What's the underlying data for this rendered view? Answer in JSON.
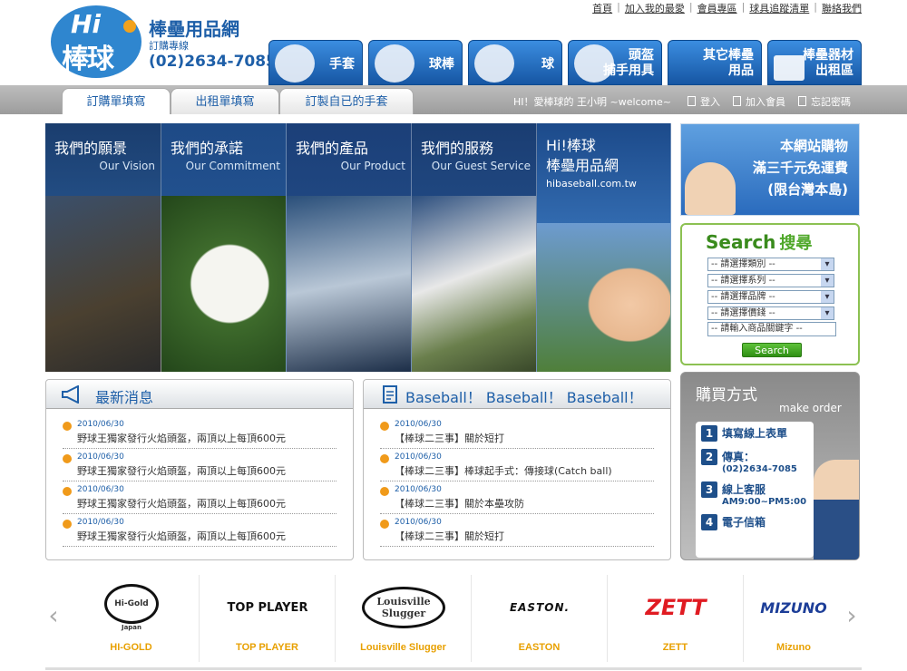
{
  "brand": {
    "logo_text": "Hi! 棒球",
    "name": "棒壘用品網",
    "order_label": "訂購專線",
    "phone": "(02)2634-7085"
  },
  "top_links": [
    "首頁",
    "加入我的最愛",
    "會員專區",
    "球具追蹤清單",
    "聯絡我們"
  ],
  "nav": [
    {
      "label": "手套",
      "icon": "glove-icon"
    },
    {
      "label": "球棒",
      "icon": "batter-icon"
    },
    {
      "label": "球",
      "icon": "ball-player-icon"
    },
    {
      "label": "頭盔\n捕手用具",
      "icon": "catcher-helmet-icon"
    },
    {
      "label": "其它棒壘\n用品",
      "icon": "equipment-icon"
    },
    {
      "label": "棒壘器材\n出租區",
      "icon": "scoreboard-icon"
    }
  ],
  "tabs": [
    "訂購單填寫",
    "出租單填寫",
    "訂製自已的手套"
  ],
  "welcome": "HI！愛棒球的 王小明 ~welcome~",
  "user_links": [
    "登入",
    "加入會員",
    "忘記密碼"
  ],
  "banner": [
    {
      "title": "我們的願景",
      "subtitle": "Our Vision"
    },
    {
      "title": "我們的承諾",
      "subtitle": "Our Commitment"
    },
    {
      "title": "我們的產品",
      "subtitle": "Our Product"
    },
    {
      "title": "我們的服務",
      "subtitle": "Our Guest Service"
    },
    {
      "title": "Hi!棒球\n棒壘用品網",
      "subtitle": "hibaseball.com.tw"
    }
  ],
  "promo": {
    "line1": "本網站購物",
    "line2": "滿三千元免運費",
    "line3": "(限台灣本島)"
  },
  "search": {
    "title": "Search",
    "title_zh": "搜尋",
    "selects": [
      "-- 請選擇類別 --",
      "-- 請選擇系列 --",
      "-- 請選擇品牌 --",
      "-- 請選擇價錢 --"
    ],
    "keyword_placeholder": "-- 請輸入商品關鍵字 --",
    "button": "Search"
  },
  "howto": {
    "title": "購買方式",
    "subtitle": "make order",
    "steps": [
      {
        "n": "1",
        "label": "填寫線上表單",
        "sub": ""
      },
      {
        "n": "2",
        "label": "傳真：",
        "sub": "(02)2634-7085"
      },
      {
        "n": "3",
        "label": "線上客服",
        "sub": "AM9:00~PM5:00"
      },
      {
        "n": "4",
        "label": "電子信箱",
        "sub": ""
      }
    ]
  },
  "news": {
    "title": "最新消息",
    "items": [
      {
        "date": "2010/06/30",
        "text": "野球王獨家發行火焰頭盔，兩頂以上每頂600元"
      },
      {
        "date": "2010/06/30",
        "text": "野球王獨家發行火焰頭盔，兩頂以上每頂600元"
      },
      {
        "date": "2010/06/30",
        "text": "野球王獨家發行火焰頭盔，兩頂以上每頂600元"
      },
      {
        "date": "2010/06/30",
        "text": "野球王獨家發行火焰頭盔，兩頂以上每頂600元"
      }
    ]
  },
  "baseball": {
    "title": "Baseball！ Baseball！ Baseball！",
    "items": [
      {
        "date": "2010/06/30",
        "text": "【棒球二三事】關於短打"
      },
      {
        "date": "2010/06/30",
        "text": "【棒球二三事】棒球起手式：傳接球(Catch ball)"
      },
      {
        "date": "2010/06/30",
        "text": "【棒球二三事】關於本壘攻防"
      },
      {
        "date": "2010/06/30",
        "text": "【棒球二三事】關於短打"
      }
    ]
  },
  "brands": [
    {
      "name": "HI-GOLD",
      "logo": "Hi-Gold",
      "sublogo": "Japan"
    },
    {
      "name": "TOP PLAYER",
      "logo": "TOP PLAYER",
      "sublogo": ""
    },
    {
      "name": "Louisville Slugger",
      "logo": "Louisville Slugger",
      "sublogo": ""
    },
    {
      "name": "EASTON",
      "logo": "EASTON.",
      "sublogo": ""
    },
    {
      "name": "ZETT",
      "logo": "ZETT",
      "sublogo": ""
    },
    {
      "name": "Mizuno",
      "logo": "MIZUNO",
      "sublogo": ""
    }
  ],
  "colors": {
    "brand_blue": "#1e5fa8",
    "accent_orange": "#f09a1a",
    "search_green": "#3a8b1d"
  }
}
